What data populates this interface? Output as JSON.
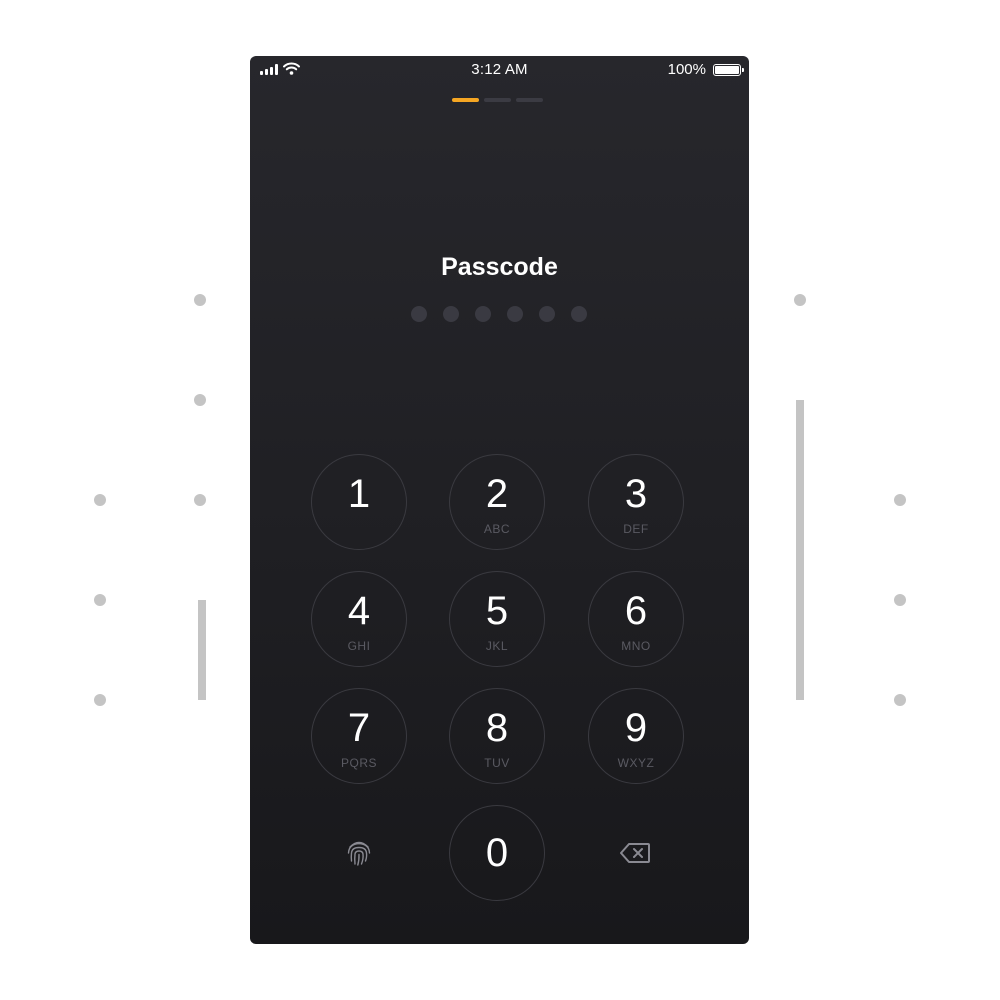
{
  "status_bar": {
    "time": "3:12 AM",
    "battery_percent": "100%",
    "icons": [
      "signal-icon",
      "wifi-icon",
      "battery-icon"
    ]
  },
  "progress": {
    "steps": 3,
    "current_step": 1,
    "active_color": "#f5a623"
  },
  "title": "Passcode",
  "passcode": {
    "length": 6,
    "filled": 0
  },
  "keypad": {
    "keys": [
      {
        "digit": "1",
        "letters": ""
      },
      {
        "digit": "2",
        "letters": "ABC"
      },
      {
        "digit": "3",
        "letters": "DEF"
      },
      {
        "digit": "4",
        "letters": "GHI"
      },
      {
        "digit": "5",
        "letters": "JKL"
      },
      {
        "digit": "6",
        "letters": "MNO"
      },
      {
        "digit": "7",
        "letters": "PQRS"
      },
      {
        "digit": "8",
        "letters": "TUV"
      },
      {
        "digit": "9",
        "letters": "WXYZ"
      },
      {
        "digit": "0",
        "letters": ""
      }
    ],
    "left_action_icon": "fingerprint-icon",
    "right_action_icon": "backspace-icon"
  },
  "colors": {
    "background": "#1f1f23",
    "accent": "#f5a623"
  }
}
